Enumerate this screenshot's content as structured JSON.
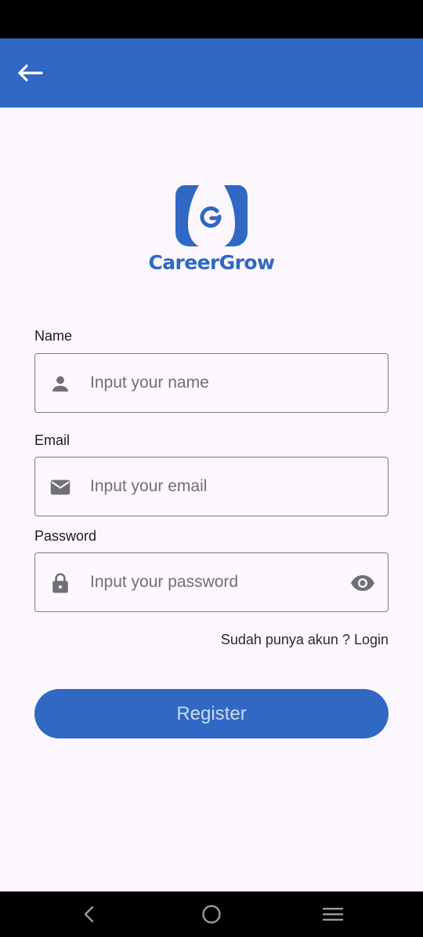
{
  "app_bar": {
    "back_icon": "arrow-left-icon",
    "background": "#3068C3"
  },
  "logo": {
    "text": "CareerGrow",
    "brand_color": "#3068C3"
  },
  "form": {
    "name": {
      "label": "Name",
      "placeholder": "Input your name",
      "icon": "person-icon"
    },
    "email": {
      "label": "Email",
      "placeholder": "Input your email",
      "icon": "mail-icon"
    },
    "password": {
      "label": "Password",
      "placeholder": "Input your password",
      "icon": "lock-icon",
      "toggle_icon": "eye-icon"
    },
    "login_link": "Sudah punya akun ? Login",
    "register_label": "Register"
  },
  "system_nav": {
    "back_icon": "nav-back-icon",
    "home_icon": "nav-home-icon",
    "menu_icon": "nav-menu-icon"
  }
}
